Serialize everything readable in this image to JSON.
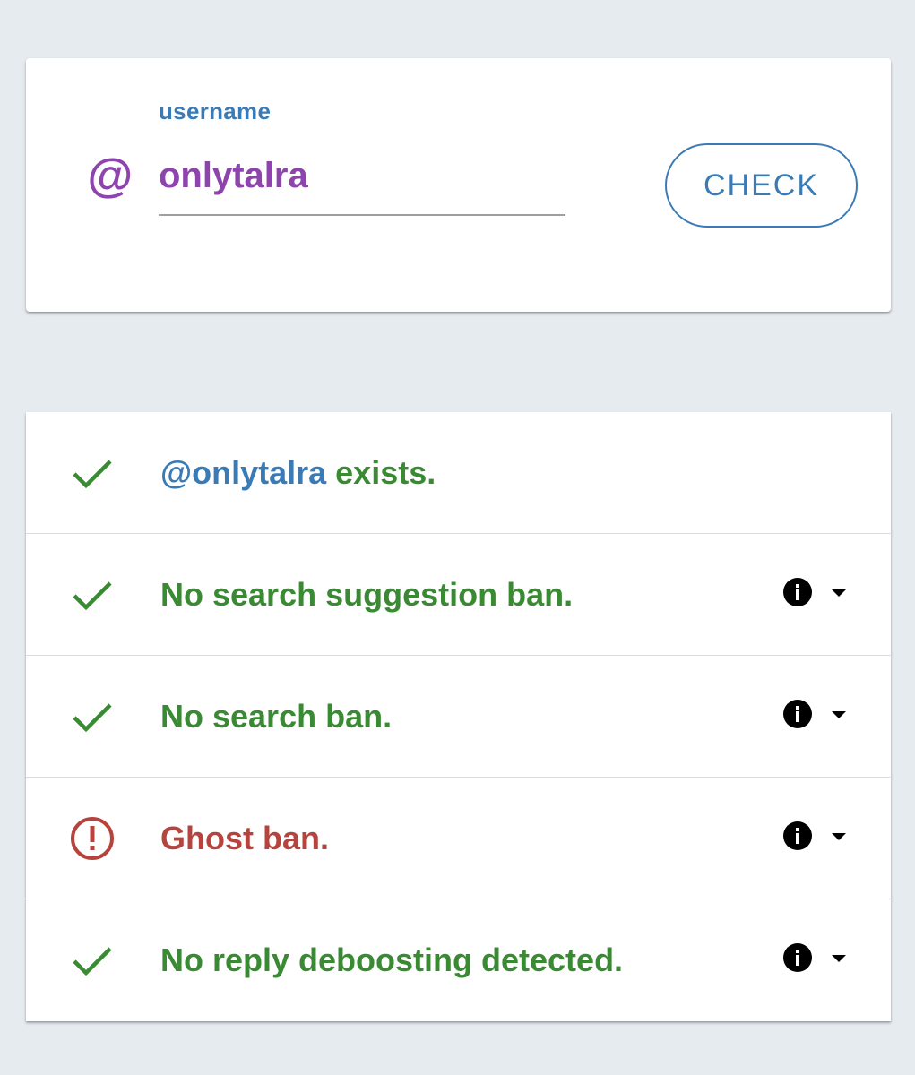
{
  "search": {
    "label": "username",
    "value": "onlytalra",
    "at_symbol": "@",
    "button_label": "CHECK",
    "accent_color": "#8e44ad",
    "primary_color": "#3b7bb5"
  },
  "results": [
    {
      "status": "ok",
      "icon": "check-icon",
      "handle": "@onlytalra",
      "text": " exists.",
      "has_details": false
    },
    {
      "status": "ok",
      "icon": "check-icon",
      "text": "No search suggestion ban.",
      "has_details": true
    },
    {
      "status": "ok",
      "icon": "check-icon",
      "text": "No search ban.",
      "has_details": true
    },
    {
      "status": "bad",
      "icon": "alert-circle-icon",
      "text": "Ghost ban.",
      "has_details": true
    },
    {
      "status": "ok",
      "icon": "check-icon",
      "text": "No reply deboosting detected.",
      "has_details": true
    }
  ],
  "colors": {
    "ok": "#3a8a34",
    "bad": "#b5443f",
    "background": "#e6ebf0"
  }
}
